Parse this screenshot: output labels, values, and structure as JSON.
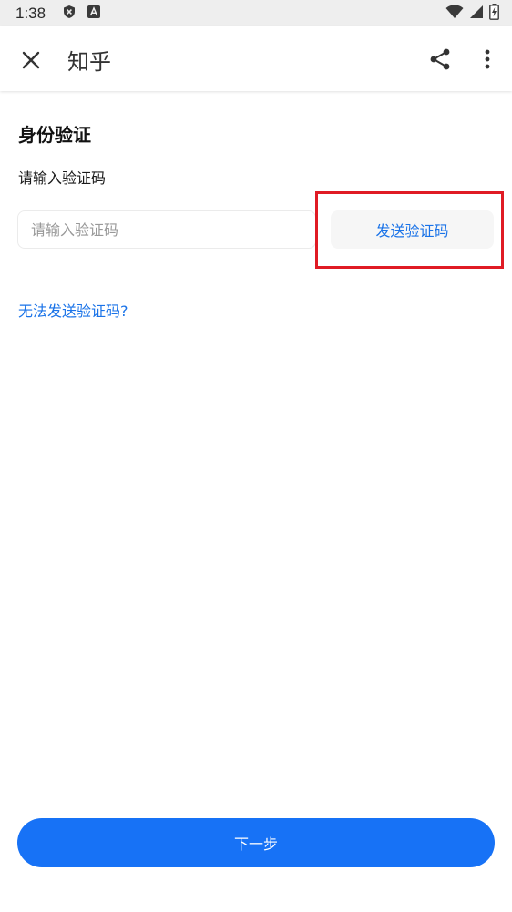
{
  "status_bar": {
    "time": "1:38",
    "icons": [
      "shield-x-icon",
      "font-a-icon",
      "wifi-icon",
      "signal-icon",
      "battery-charging-icon"
    ]
  },
  "app_bar": {
    "title": "知乎",
    "icons": [
      "close-icon",
      "share-icon",
      "more-vert-icon"
    ]
  },
  "main": {
    "title": "身份验证",
    "subtitle": "请输入验证码",
    "code_input": {
      "placeholder": "请输入验证码",
      "value": ""
    },
    "send_code_label": "发送验证码",
    "help_link": "无法发送验证码?"
  },
  "footer": {
    "next_label": "下一步"
  },
  "colors": {
    "primary": "#1772f6",
    "link": "#1a73e8",
    "highlight": "#e01b24"
  }
}
